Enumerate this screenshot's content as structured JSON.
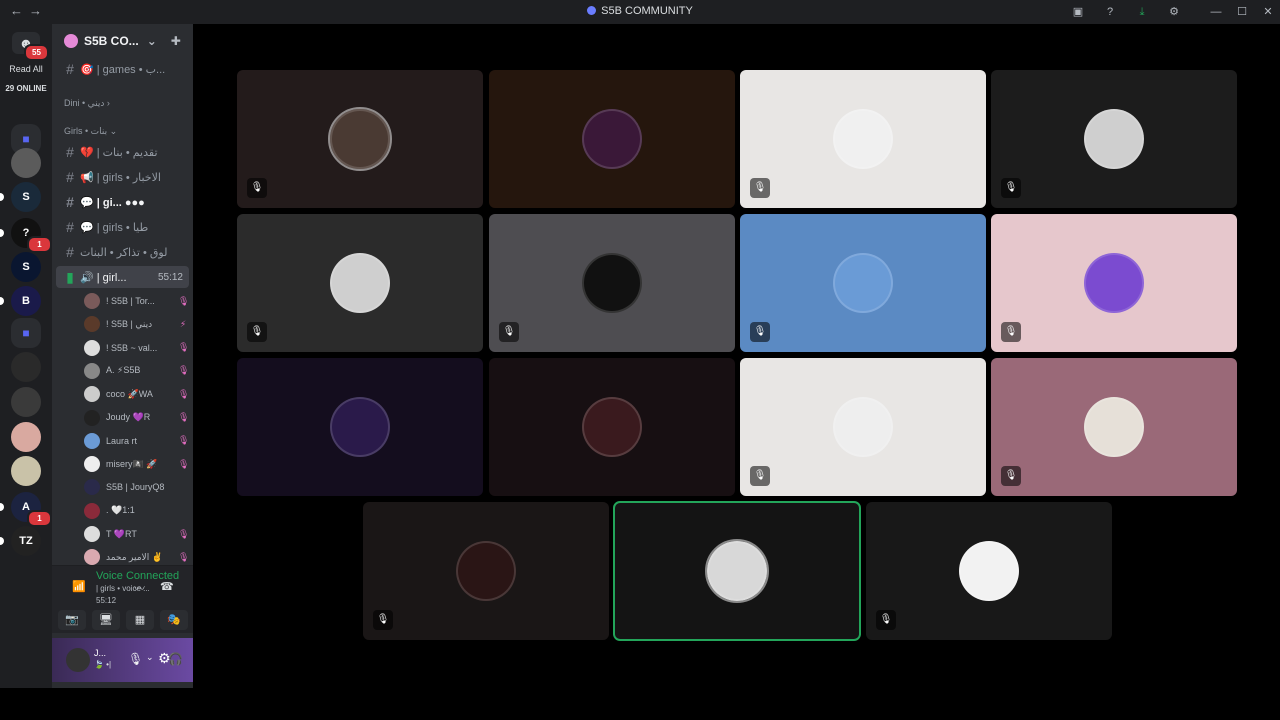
{
  "window": {
    "title": "S5B COMMUNITY",
    "nav_back": "←",
    "nav_forward": "→",
    "icons": [
      "inbox-icon",
      "help-icon",
      "download-icon",
      "nitro-icon",
      "minimize-icon",
      "maximize-icon",
      "close-icon"
    ],
    "icon_glyphs": [
      "▣",
      "?",
      "⤓",
      "⚙",
      "—",
      "☐",
      "✕"
    ]
  },
  "rail": {
    "logo_glyph": "☻",
    "logo_badge": "55",
    "read_all": "Read All",
    "online": "29 ONLINE",
    "servers": [
      {
        "glyph": "",
        "color": "#5b5b5b",
        "badge": ""
      },
      {
        "glyph": "S",
        "color": "#1a2a3a",
        "badge": ""
      },
      {
        "glyph": "?",
        "color": "#111111",
        "badge": "1"
      },
      {
        "glyph": "S",
        "color": "#0a1630",
        "badge": ""
      },
      {
        "glyph": "B",
        "color": "#1a1a4a",
        "badge": ""
      },
      {
        "glyph": "",
        "color": "#2a2a2a",
        "badge": ""
      },
      {
        "glyph": "",
        "color": "#3a3a3a",
        "badge": ""
      },
      {
        "glyph": "",
        "color": "#d9a9a0",
        "badge": ""
      },
      {
        "glyph": "",
        "color": "#c9c2a8",
        "badge": ""
      },
      {
        "glyph": "A",
        "color": "#1c2340",
        "badge": "1"
      },
      {
        "glyph": "TZ",
        "color": "#222222",
        "badge": ""
      }
    ]
  },
  "sidebar": {
    "server_name": "S5B CO...",
    "chevron": "⌄",
    "add_member": "✚",
    "channels_top": [
      {
        "label": "🎯 | games • ب...",
        "icon": "#"
      }
    ],
    "category_dini": "Dini • دیني ›",
    "category_girls": "Girls • بنات ⌄",
    "channels": [
      {
        "label": "💔 | تقديم • بنات",
        "icon": "#",
        "active": false
      },
      {
        "label": "📢 | girls • الاخبار",
        "icon": "#",
        "active": false
      },
      {
        "label": "💬 | gi... ●●●",
        "icon": "#",
        "active": true
      },
      {
        "label": "💬 | girls • طيا",
        "icon": "#",
        "active": false
      },
      {
        "label": "لوق • تذاكر • البنات",
        "icon": "#",
        "active": false
      }
    ],
    "voice_channel": {
      "label": "🔊 | girl...",
      "timer": "55:12"
    },
    "members": [
      {
        "name": "! S5B | Tor...",
        "color": "#7a5a5a",
        "mic": "🎙"
      },
      {
        "name": "! S5B | ديني",
        "color": "#5a3a2a",
        "mic": "⚡"
      },
      {
        "name": "! S5B ~ val...",
        "color": "#dddddd",
        "mic": "🎙"
      },
      {
        "name": "A. ⚡S5B",
        "color": "#888888",
        "mic": "🎙"
      },
      {
        "name": "coco 🚀WA",
        "color": "#cccccc",
        "mic": "🎙"
      },
      {
        "name": "Joudy 💜R",
        "color": "#222222",
        "mic": "🎙"
      },
      {
        "name": "Laura rt",
        "color": "#6b9bd6",
        "mic": "🎙"
      },
      {
        "name": "misery🏴‍☠️ 🚀",
        "color": "#eeeeee",
        "mic": "🎙"
      },
      {
        "name": "S5B | JouryQ8",
        "color": "#2a2a4a",
        "mic": ""
      },
      {
        "name": ". 🤍1:1",
        "color": "#8a2a3a",
        "mic": ""
      },
      {
        "name": "T 💜RT",
        "color": "#dddddd",
        "mic": "🎙"
      },
      {
        "name": "الامير محمد ✌️",
        "color": "#d9a9b0",
        "mic": "🎙"
      }
    ]
  },
  "voice_panel": {
    "status": "Voice Connected",
    "channel": "| girls • voice ...",
    "timer": "55:12",
    "buttons": [
      "📷",
      "🖥",
      "▦",
      "🎭"
    ],
    "signal_icon": "📶",
    "noise_icon": "〰",
    "disconnect_icon": "☎"
  },
  "user_panel": {
    "username": "J...",
    "status_icons": "🍃 •|",
    "mic": "🎙",
    "headset": "🎧",
    "settings": "⚙",
    "chevron": "⌄"
  },
  "stage": {
    "tiles": [
      {
        "bg": "#231b1b",
        "avatar": "#4a3a33",
        "muted": true,
        "ring": true
      },
      {
        "bg": "#25160d",
        "avatar": "#3a1838",
        "muted": false,
        "ring": false
      },
      {
        "bg": "#e8e6e4",
        "avatar": "#f0f0f0",
        "muted": true,
        "ring": false
      },
      {
        "bg": "#1c1c1c",
        "avatar": "#cfcfcf",
        "muted": true,
        "ring": false
      },
      {
        "bg": "#2b2b2b",
        "avatar": "#cfcfcf",
        "muted": true,
        "ring": false
      },
      {
        "bg": "#4e4d51",
        "avatar": "#111111",
        "muted": true,
        "ring": false
      },
      {
        "bg": "#5b8ac3",
        "avatar": "#6a9bd6",
        "muted": true,
        "ring": false
      },
      {
        "bg": "#e6c7cc",
        "avatar": "#7b4bd0",
        "muted": true,
        "ring": false
      },
      {
        "bg": "#140d1e",
        "avatar": "#2a1a4a",
        "muted": false,
        "ring": false
      },
      {
        "bg": "#170f12",
        "avatar": "#3a1a1e",
        "muted": false,
        "ring": false
      },
      {
        "bg": "#e8e6e4",
        "avatar": "#eeeeee",
        "muted": true,
        "ring": false
      },
      {
        "bg": "#9a6978",
        "avatar": "#e6e0d8",
        "muted": true,
        "ring": false
      },
      {
        "bg": "#1a1616",
        "avatar": "#2a1515",
        "muted": true,
        "ring": false
      },
      {
        "bg": "#141414",
        "avatar": "#d8d8d8",
        "muted": false,
        "ring": true,
        "speaking": true
      },
      {
        "bg": "#181818",
        "avatar": "#f2f2f2",
        "muted": true,
        "ring": false
      }
    ],
    "mute_glyph": "🎙"
  }
}
